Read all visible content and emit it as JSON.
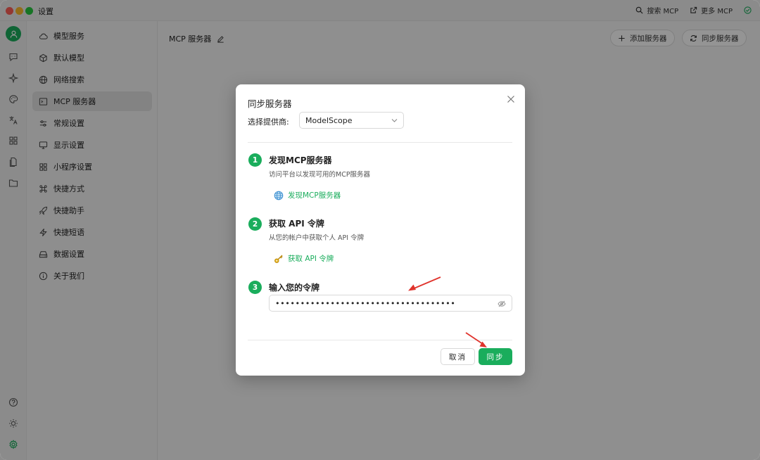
{
  "window": {
    "title": "设置"
  },
  "titlebar": {
    "search_mcp": "搜索 MCP",
    "more_mcp": "更多 MCP"
  },
  "rail": {
    "icons": [
      "chat-icon",
      "sparkle-icon",
      "palette-icon",
      "translate-icon",
      "apps-icon",
      "file-icon",
      "folder-icon",
      "help-icon",
      "brightness-icon",
      "settings-icon"
    ]
  },
  "sidebar": {
    "items": [
      {
        "label": "模型服务",
        "icon": "cloud-icon"
      },
      {
        "label": "默认模型",
        "icon": "cube-icon"
      },
      {
        "label": "网络搜索",
        "icon": "globe-icon"
      },
      {
        "label": "MCP 服务器",
        "icon": "terminal-icon",
        "active": true
      },
      {
        "label": "常规设置",
        "icon": "sliders-icon"
      },
      {
        "label": "显示设置",
        "icon": "monitor-icon"
      },
      {
        "label": "小程序设置",
        "icon": "grid-icon"
      },
      {
        "label": "快捷方式",
        "icon": "command-icon"
      },
      {
        "label": "快捷助手",
        "icon": "rocket-icon"
      },
      {
        "label": "快捷短语",
        "icon": "zap-icon"
      },
      {
        "label": "数据设置",
        "icon": "drive-icon"
      },
      {
        "label": "关于我们",
        "icon": "info-icon"
      }
    ]
  },
  "main": {
    "title": "MCP 服务器",
    "add_server": "添加服务器",
    "sync_server": "同步服务器"
  },
  "modal": {
    "title": "同步服务器",
    "provider_label": "选择提供商:",
    "provider_value": "ModelScope",
    "steps": [
      {
        "num": "1",
        "title": "发现MCP服务器",
        "desc": "访问平台以发现可用的MCP服务器",
        "link": "发现MCP服务器"
      },
      {
        "num": "2",
        "title": "获取 API 令牌",
        "desc": "从您的帐户中获取个人 API 令牌",
        "link": "获取 API 令牌"
      },
      {
        "num": "3",
        "title": "输入您的令牌"
      }
    ],
    "token_value": "••••••••••••••••••••••••••••••••••••",
    "cancel": "取消",
    "sync": "同步"
  },
  "colors": {
    "accent": "#1aad5c",
    "arrow": "#e0332c"
  }
}
